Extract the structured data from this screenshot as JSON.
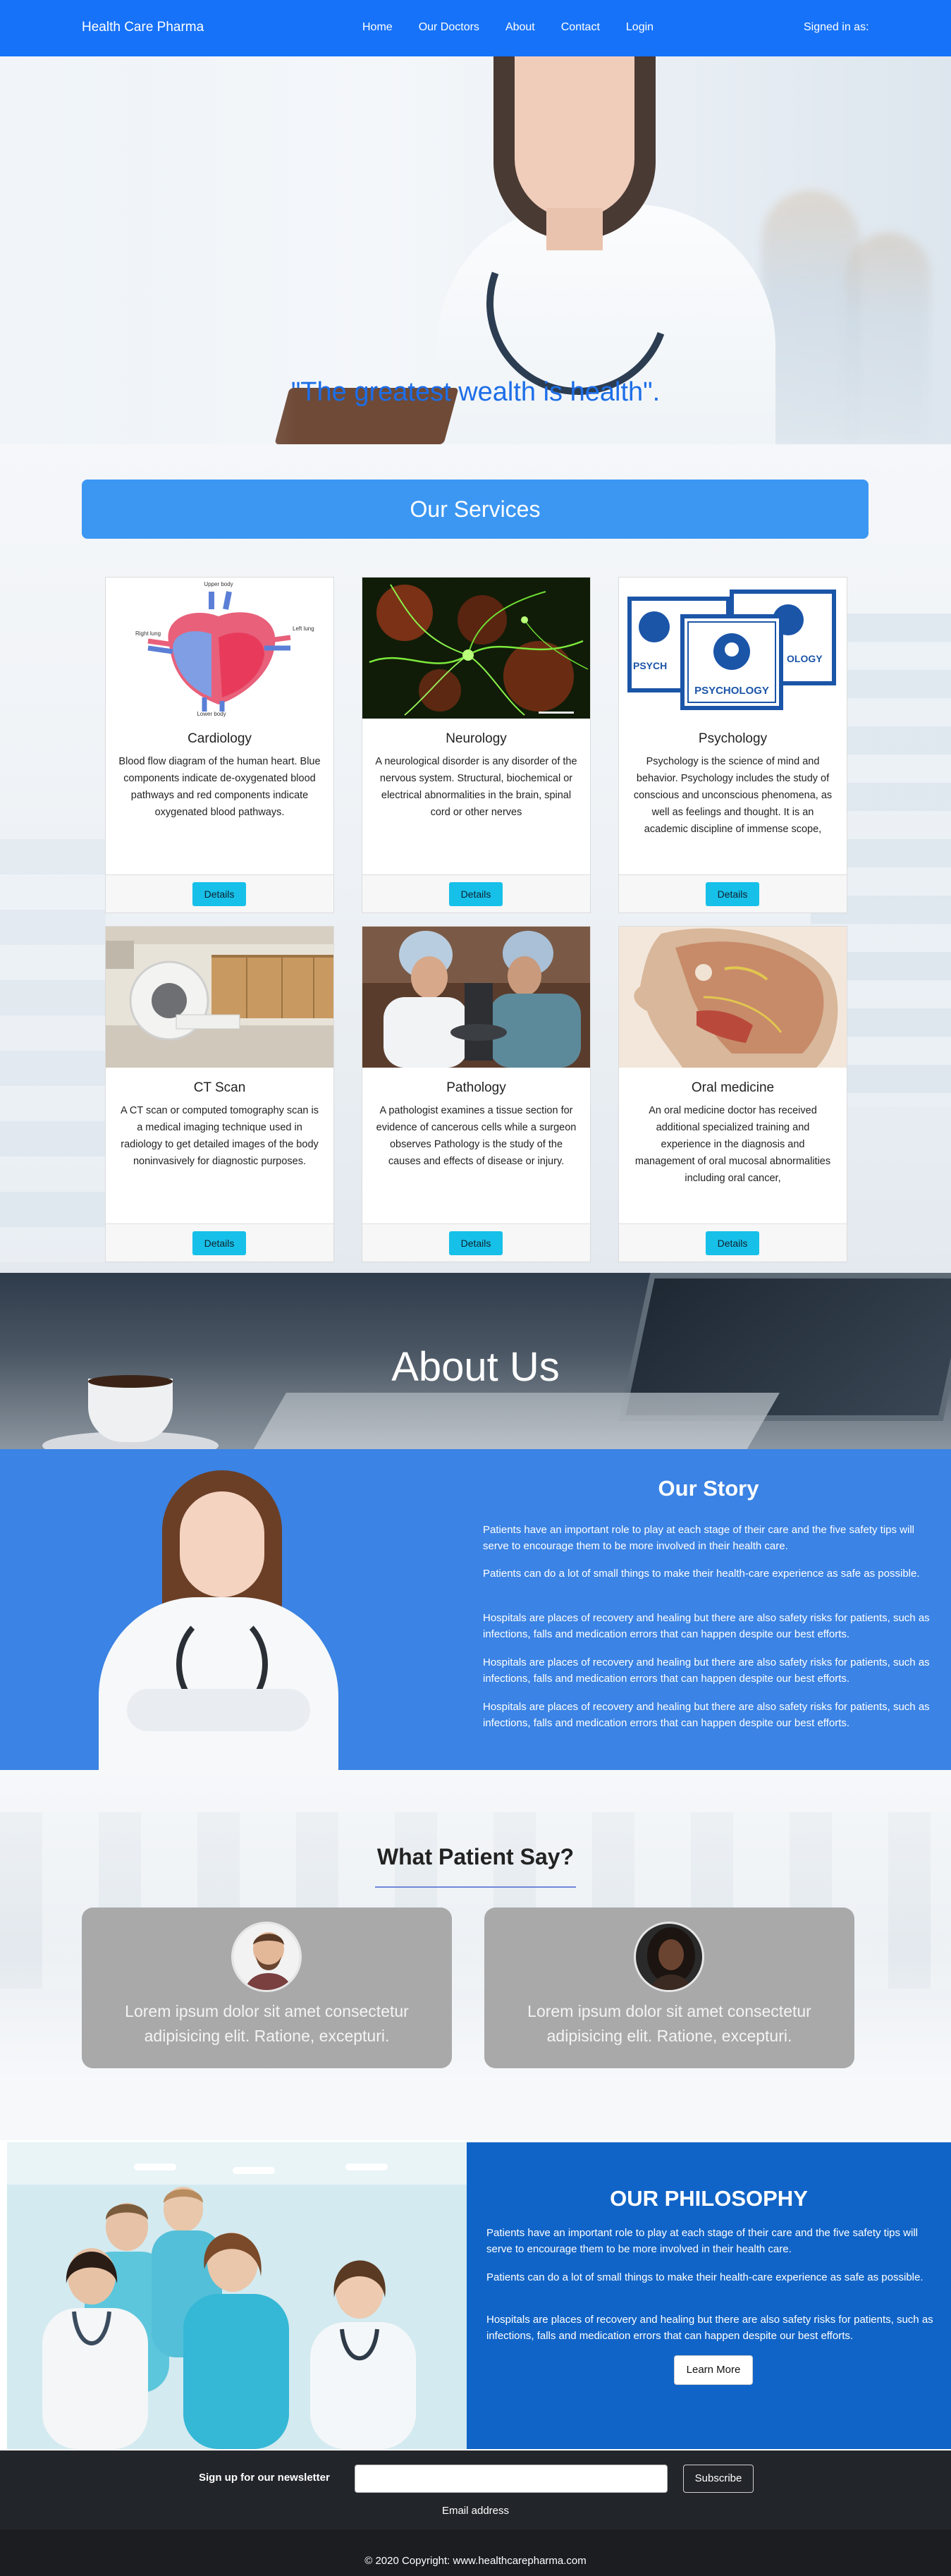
{
  "nav": {
    "brand": "Health Care Pharma",
    "links": [
      "Home",
      "Our Doctors",
      "About",
      "Contact",
      "Login"
    ],
    "signed_in": "Signed in as:"
  },
  "hero": {
    "quote": "\"The greatest wealth is health\"."
  },
  "services": {
    "heading": "Our Services",
    "cards": [
      {
        "title": "Cardiology",
        "desc": "Blood flow diagram of the human heart. Blue components indicate de-oxygenated blood pathways and red components indicate oxygenated blood pathways.",
        "button": "Details",
        "img_labels": [
          "Upper body",
          "Right lung",
          "Left lung",
          "Lower body"
        ]
      },
      {
        "title": "Neurology",
        "desc": "A neurological disorder is any disorder of the nervous system. Structural, biochemical or electrical abnormalities in the brain, spinal cord or other nerves",
        "button": "Details"
      },
      {
        "title": "Psychology",
        "desc": "Psychology is the science of mind and behavior. Psychology includes the study of conscious and unconscious phenomena, as well as feelings and thought. It is an academic discipline of immense scope,",
        "button": "Details",
        "img_labels": [
          "PSYCHOLOGY",
          "PSYCH",
          "OLOGY"
        ]
      },
      {
        "title": "CT Scan",
        "desc": "A CT scan or computed tomography scan is a medical imaging technique used in radiology to get detailed images of the body noninvasively for diagnostic purposes.",
        "button": "Details"
      },
      {
        "title": "Pathology",
        "desc": "A pathologist examines a tissue section for evidence of cancerous cells while a surgeon observes Pathology is the study of the causes and effects of disease or injury.",
        "button": "Details"
      },
      {
        "title": "Oral medicine",
        "desc": "An oral medicine doctor has received additional specialized training and experience in the diagnosis and management of oral mucosal abnormalities including oral cancer,",
        "button": "Details"
      }
    ]
  },
  "about": {
    "heading": "About Us"
  },
  "story": {
    "heading": "Our Story",
    "paragraphs": [
      "Patients have an important role to play at each stage of their care and the five safety tips will serve to encourage them to be more involved in their health care.",
      "Patients can do a lot of small things to make their health-care experience as safe as possible.",
      "Hospitals are places of recovery and healing but there are also safety risks for patients, such as infections, falls and medication errors that can happen despite our best efforts.",
      "Hospitals are places of recovery and healing but there are also safety risks for patients, such as infections, falls and medication errors that can happen despite our best efforts.",
      "Hospitals are places of recovery and healing but there are also safety risks for patients, such as infections, falls and medication errors that can happen despite our best efforts."
    ]
  },
  "testimonials": {
    "heading": "What Patient Say?",
    "items": [
      {
        "text": "Lorem ipsum dolor sit amet consectetur adipisicing elit. Ratione, excepturi."
      },
      {
        "text": "Lorem ipsum dolor sit amet consectetur adipisicing elit. Ratione, excepturi."
      }
    ]
  },
  "philosophy": {
    "heading": "OUR PHILOSOPHY",
    "paragraphs": [
      "Patients have an important role to play at each stage of their care and the five safety tips will serve to encourage them to be more involved in their health care.",
      "Patients can do a lot of small things to make their health-care experience as safe as possible.",
      "Hospitals are places of recovery and healing but there are also safety risks for patients, such as infections, falls and medication errors that can happen despite our best efforts."
    ],
    "button": "Learn More"
  },
  "newsletter": {
    "label": "Sign up for our newsletter",
    "input_value": "",
    "button": "Subscribe",
    "email_label": "Email address"
  },
  "footer": {
    "copyright": "© 2020 Copyright: www.healthcarepharma.com"
  },
  "colors": {
    "nav": "#1672f9",
    "services_banner": "#3c97f3",
    "story_bg": "#3b83e4",
    "philosophy_bg": "#1164c7",
    "details_button": "#17c0e8",
    "footer": "#1b1d21"
  }
}
